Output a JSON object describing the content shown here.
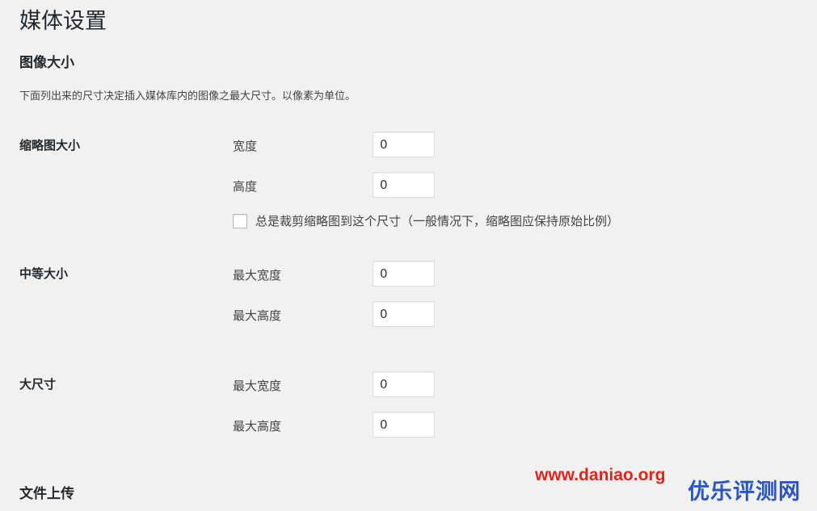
{
  "page_title": "媒体设置",
  "image_sizes": {
    "title": "图像大小",
    "description": "下面列出来的尺寸决定插入媒体库内的图像之最大尺寸。以像素为单位。",
    "thumbnail": {
      "label": "缩略图大小",
      "width_label": "宽度",
      "width_value": "0",
      "height_label": "高度",
      "height_value": "0",
      "crop_label": "总是裁剪缩略图到这个尺寸（一般情况下，缩略图应保持原始比例）",
      "crop_checked": false
    },
    "medium": {
      "label": "中等大小",
      "max_width_label": "最大宽度",
      "max_width_value": "0",
      "max_height_label": "最大高度",
      "max_height_value": "0"
    },
    "large": {
      "label": "大尺寸",
      "max_width_label": "最大宽度",
      "max_width_value": "0",
      "max_height_label": "最大高度",
      "max_height_value": "0"
    }
  },
  "uploads": {
    "title": "文件上传"
  },
  "watermark": {
    "url": "www.daniao.org",
    "brand": "优乐评测网"
  }
}
